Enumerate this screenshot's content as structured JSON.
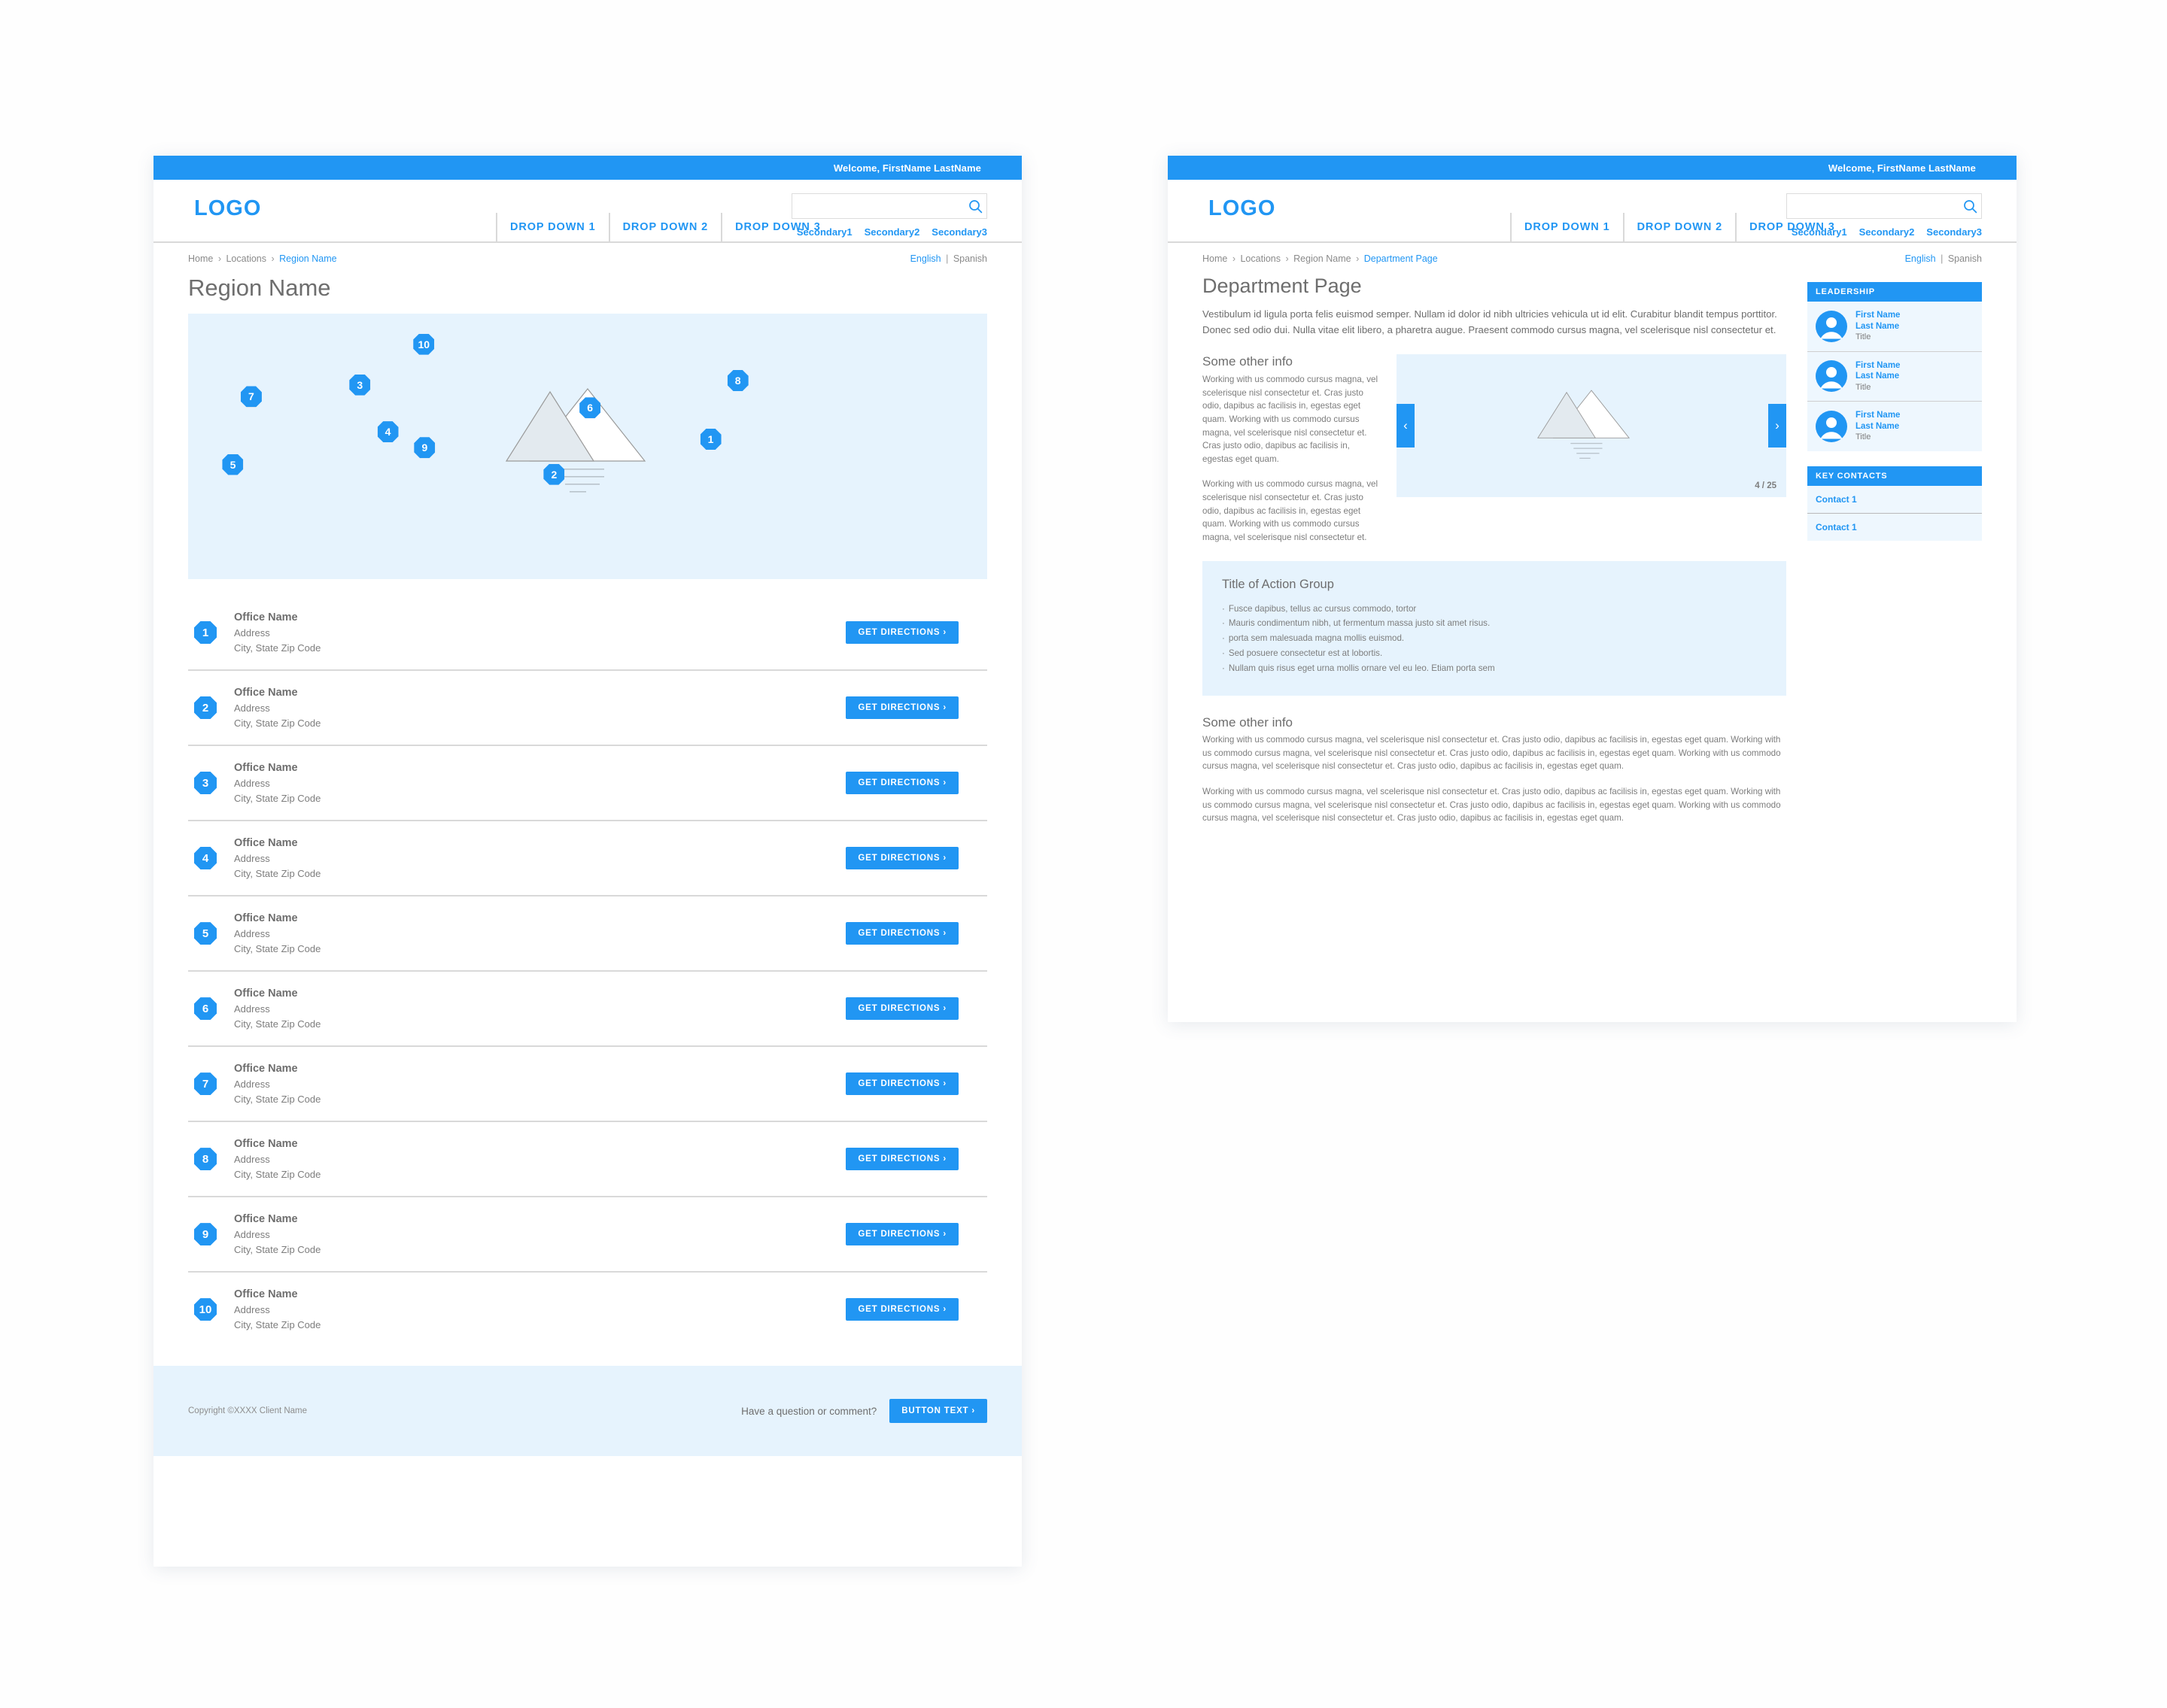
{
  "colors": {
    "accent": "#2196f3",
    "panel_tint": "#e6f3fd",
    "widget_tint": "#eef7fe",
    "text_gray": "#6e6e6e",
    "body_gray": "#7d7d7d",
    "rule": "#d9d9d9"
  },
  "chrome": {
    "welcome": "Welcome, FirstName LastName",
    "logo": "LOGO",
    "nav": [
      {
        "label": "DROP DOWN 1"
      },
      {
        "label": "DROP DOWN 2"
      },
      {
        "label": "DROP DOWN 3"
      }
    ],
    "secondary": [
      {
        "label": "Secondary1"
      },
      {
        "label": "Secondary2"
      },
      {
        "label": "Secondary3"
      }
    ],
    "search": {
      "value": "",
      "placeholder": "",
      "icon": "search-icon"
    },
    "language": {
      "english": "English",
      "divider": "|",
      "spanish": "Spanish"
    }
  },
  "locations_page": {
    "breadcrumb": {
      "home": "Home",
      "locations": "Locations",
      "current": "Region Name",
      "sep": "›"
    },
    "title": "Region Name",
    "map": {
      "placeholder_icon": "image-placeholder-icon",
      "markers": [
        {
          "label": "10",
          "x": 29.5,
          "y": 11.5
        },
        {
          "label": "8",
          "x": 68.8,
          "y": 25.2
        },
        {
          "label": "3",
          "x": 21.5,
          "y": 26.8
        },
        {
          "label": "7",
          "x": 7.9,
          "y": 31.3
        },
        {
          "label": "6",
          "x": 50.3,
          "y": 35.5
        },
        {
          "label": "1",
          "x": 65.4,
          "y": 47.3
        },
        {
          "label": "4",
          "x": 25.0,
          "y": 44.5
        },
        {
          "label": "9",
          "x": 29.6,
          "y": 50.5
        },
        {
          "label": "5",
          "x": 5.6,
          "y": 56.8
        },
        {
          "label": "2",
          "x": 45.8,
          "y": 60.5
        }
      ]
    },
    "offices": [
      {
        "num": "1",
        "name": "Office Name",
        "address": "Address",
        "citystate": "City, State Zip Code",
        "cta": "GET DIRECTIONS ›"
      },
      {
        "num": "2",
        "name": "Office Name",
        "address": "Address",
        "citystate": "City, State Zip Code",
        "cta": "GET DIRECTIONS ›"
      },
      {
        "num": "3",
        "name": "Office Name",
        "address": "Address",
        "citystate": "City, State Zip Code",
        "cta": "GET DIRECTIONS ›"
      },
      {
        "num": "4",
        "name": "Office Name",
        "address": "Address",
        "citystate": "City, State Zip Code",
        "cta": "GET DIRECTIONS ›"
      },
      {
        "num": "5",
        "name": "Office Name",
        "address": "Address",
        "citystate": "City, State Zip Code",
        "cta": "GET DIRECTIONS ›"
      },
      {
        "num": "6",
        "name": "Office Name",
        "address": "Address",
        "citystate": "City, State Zip Code",
        "cta": "GET DIRECTIONS ›"
      },
      {
        "num": "7",
        "name": "Office Name",
        "address": "Address",
        "citystate": "City, State Zip Code",
        "cta": "GET DIRECTIONS ›"
      },
      {
        "num": "8",
        "name": "Office Name",
        "address": "Address",
        "citystate": "City, State Zip Code",
        "cta": "GET DIRECTIONS ›"
      },
      {
        "num": "9",
        "name": "Office Name",
        "address": "Address",
        "citystate": "City, State Zip Code",
        "cta": "GET DIRECTIONS ›"
      },
      {
        "num": "10",
        "name": "Office Name",
        "address": "Address",
        "citystate": "City, State Zip Code",
        "cta": "GET DIRECTIONS ›"
      }
    ],
    "footer": {
      "copyright": "Copyright ©XXXX Client Name",
      "question": "Have a question or comment?",
      "button": "BUTTON TEXT ›"
    }
  },
  "department_page": {
    "breadcrumb": {
      "home": "Home",
      "locations": "Locations",
      "region": "Region Name",
      "current": "Department Page",
      "sep": "›"
    },
    "title": "Department Page",
    "intro": "Vestibulum id ligula porta felis euismod semper. Nullam id dolor id nibh ultricies vehicula ut id elit. Curabitur blandit tempus porttitor. Donec sed odio dui. Nulla vitae elit libero, a pharetra augue. Praesent commodo cursus magna, vel scelerisque nisl consectetur et.",
    "info_left": {
      "heading": "Some other info",
      "paragraphs": [
        "Working with us commodo cursus magna, vel scelerisque nisl consectetur et. Cras justo odio, dapibus ac facilisis in, egestas eget quam. Working with us commodo cursus magna, vel scelerisque nisl consectetur et. Cras justo odio, dapibus ac facilisis in, egestas eget quam.",
        "Working with us commodo cursus magna, vel scelerisque nisl consectetur et. Cras justo odio, dapibus ac facilisis in, egestas eget quam. Working with us commodo cursus magna, vel scelerisque nisl consectetur et."
      ]
    },
    "carousel": {
      "prev": "‹",
      "next": "›",
      "counter": "4 / 25",
      "current": 4,
      "total": 25,
      "placeholder_icon": "image-placeholder-icon"
    },
    "action_group": {
      "title": "Title of Action Group",
      "bullets": [
        "Fusce dapibus, tellus ac cursus commodo, tortor",
        "Mauris condimentum nibh, ut fermentum massa justo sit amet risus.",
        "porta sem malesuada magna mollis euismod.",
        "Sed posuere consectetur est at lobortis.",
        "Nullam quis risus eget urna mollis ornare vel eu leo. Etiam porta sem"
      ]
    },
    "bottom_info": {
      "heading": "Some other info",
      "paragraphs": [
        "Working with us commodo cursus magna, vel scelerisque nisl consectetur et. Cras justo odio, dapibus ac facilisis in, egestas eget quam. Working with us commodo cursus magna, vel scelerisque nisl consectetur et. Cras justo odio, dapibus ac facilisis in, egestas eget quam. Working with us commodo cursus magna, vel scelerisque nisl consectetur et. Cras justo odio, dapibus ac facilisis in, egestas eget quam.",
        "Working with us commodo cursus magna, vel scelerisque nisl consectetur et. Cras justo odio, dapibus ac facilisis in, egestas eget quam. Working with us commodo cursus magna, vel scelerisque nisl consectetur et. Cras justo odio, dapibus ac facilisis in, egestas eget quam. Working with us commodo cursus magna, vel scelerisque nisl consectetur et. Cras justo odio, dapibus ac facilisis in, egestas eget quam."
      ]
    },
    "leadership": {
      "heading": "LEADERSHIP",
      "people": [
        {
          "first": "First Name",
          "last": "Last Name",
          "title": "Title"
        },
        {
          "first": "First Name",
          "last": "Last Name",
          "title": "Title"
        },
        {
          "first": "First Name",
          "last": "Last Name",
          "title": "Title"
        }
      ]
    },
    "key_contacts": {
      "heading": "KEY CONTACTS",
      "items": [
        {
          "label": "Contact 1"
        },
        {
          "label": "Contact 1"
        }
      ]
    }
  }
}
